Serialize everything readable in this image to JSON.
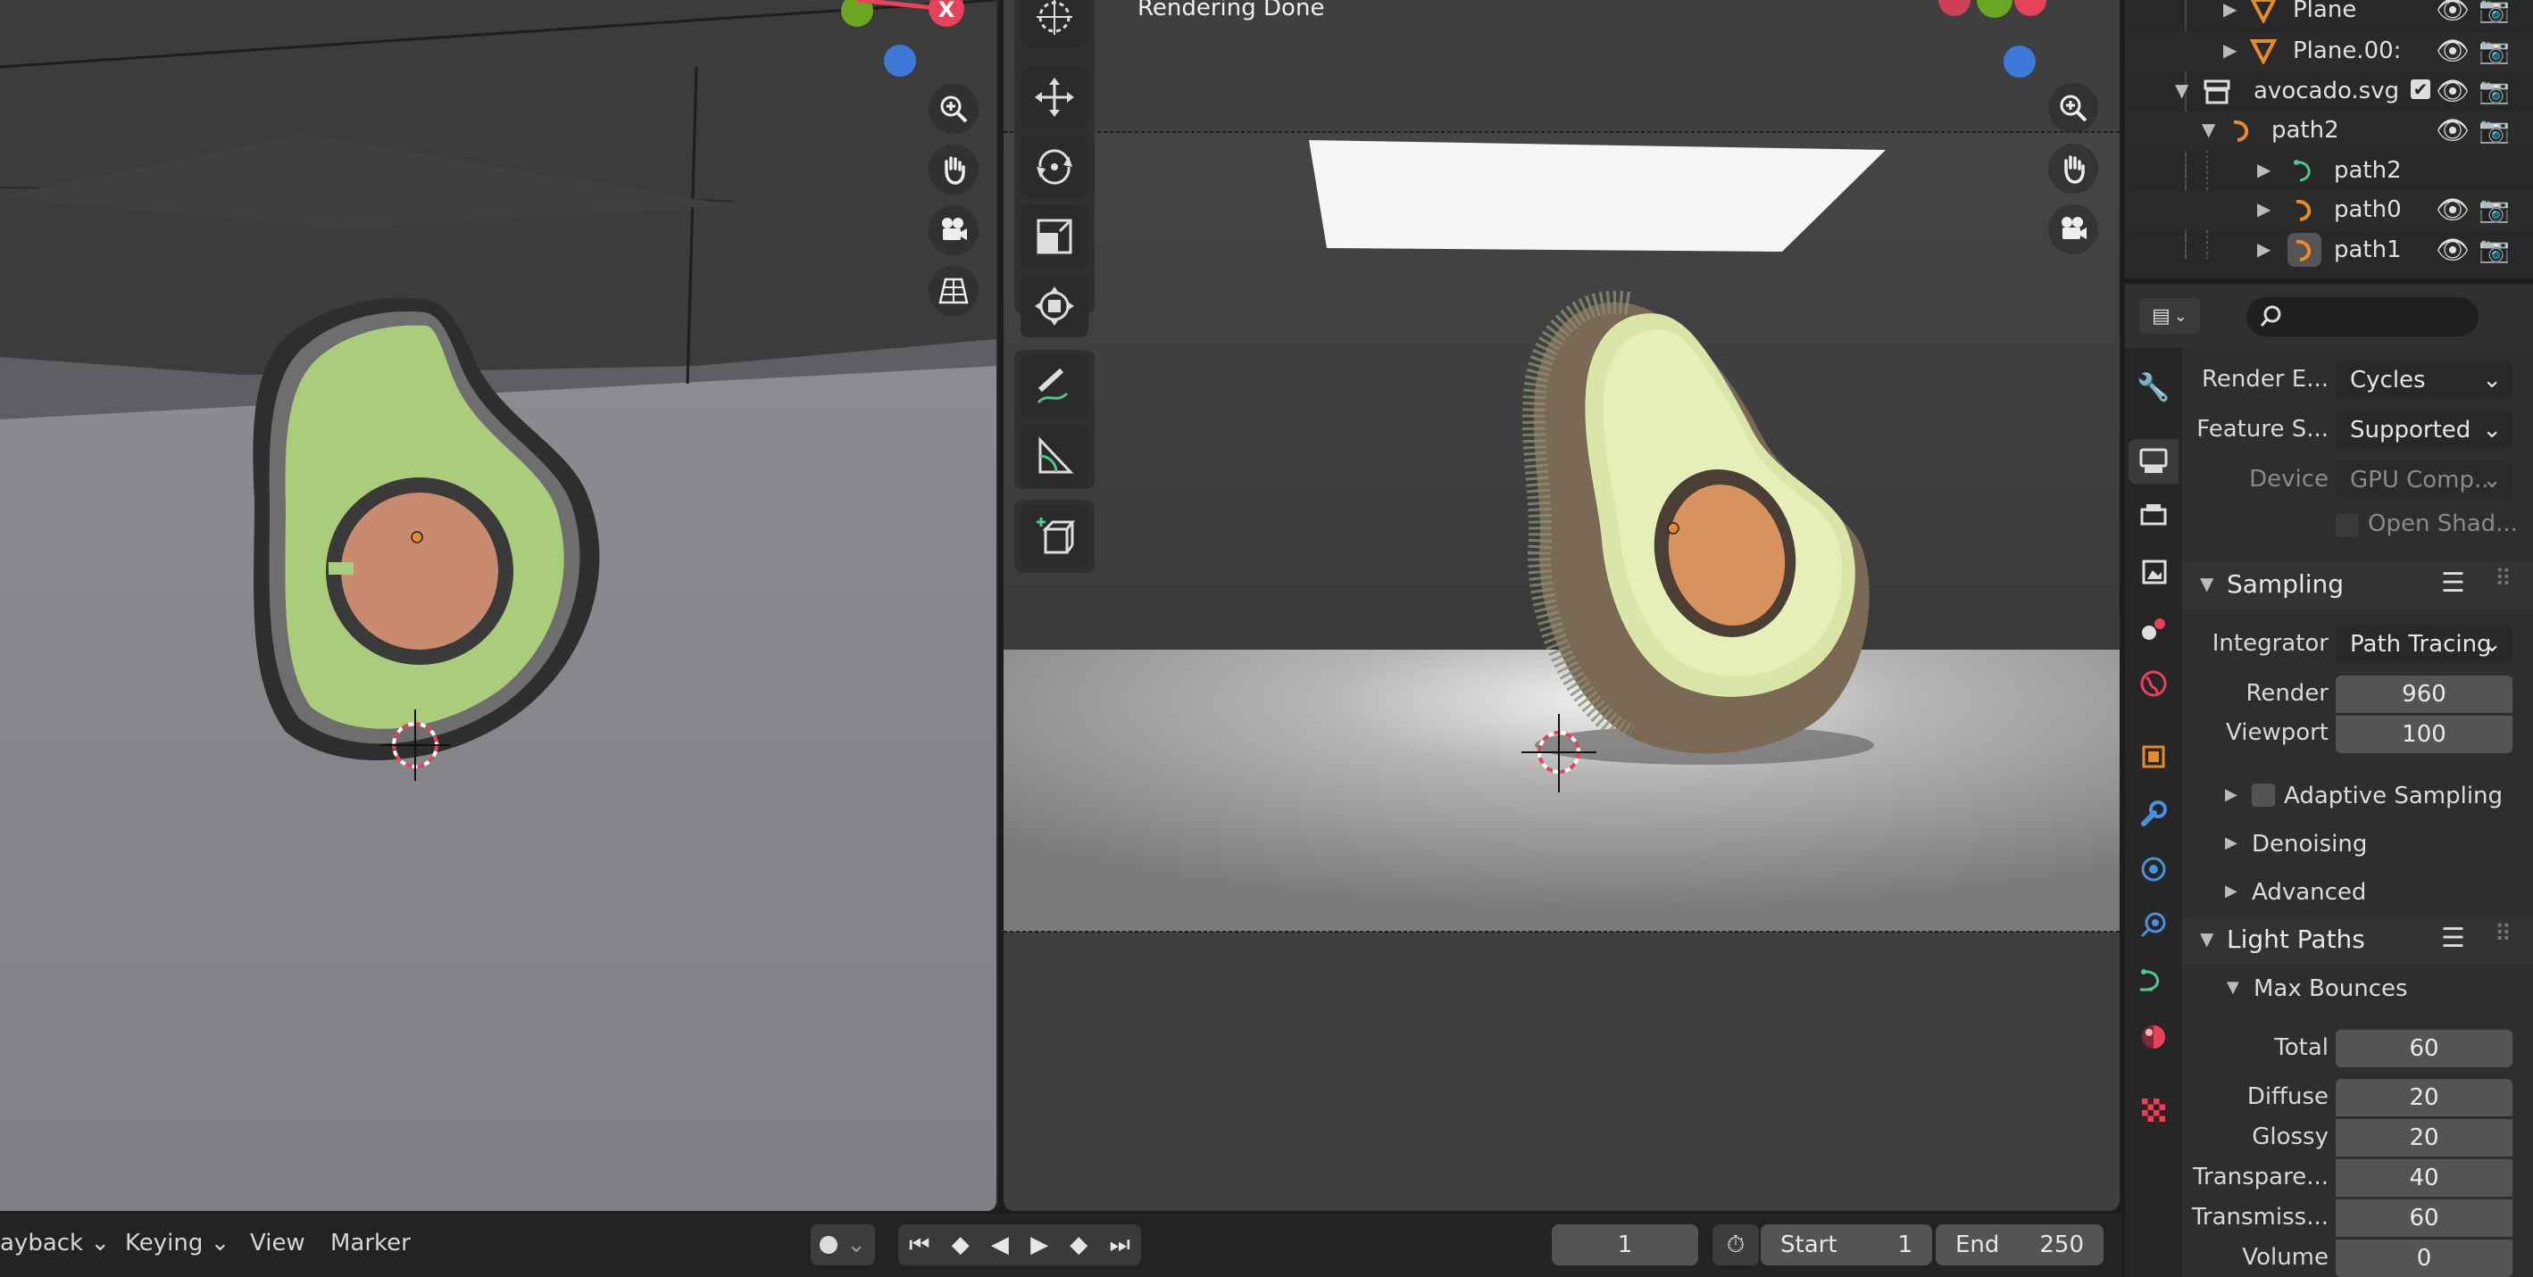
{
  "left_viewport": {},
  "right_viewport": {
    "status": "Rendering Done"
  },
  "timeline": {
    "playback_label": "ayback",
    "keying_label": "Keying",
    "view_label": "View",
    "marker_label": "Marker",
    "current_frame": "1",
    "start_label": "Start",
    "start_value": "1",
    "end_label": "End",
    "end_value": "250"
  },
  "outliner": {
    "items": [
      {
        "label": "Plane"
      },
      {
        "label": "Plane.00:"
      },
      {
        "label": "avocado.svg"
      },
      {
        "label": "path2"
      },
      {
        "label": "path2"
      },
      {
        "label": "path0"
      },
      {
        "label": "path1"
      }
    ]
  },
  "properties": {
    "render_engine_label": "Render E...",
    "render_engine_value": "Cycles",
    "feature_set_label": "Feature S...",
    "feature_set_value": "Supported",
    "device_label": "Device",
    "device_value": "GPU Comp...",
    "open_shading_label": "Open Shad...",
    "sampling": {
      "title": "Sampling",
      "integrator_label": "Integrator",
      "integrator_value": "Path Tracing",
      "render_label": "Render",
      "render_value": "960",
      "viewport_label": "Viewport",
      "viewport_value": "100",
      "adaptive_label": "Adaptive Sampling",
      "denoising_label": "Denoising",
      "advanced_label": "Advanced"
    },
    "light_paths": {
      "title": "Light Paths",
      "max_bounces_label": "Max Bounces",
      "total_label": "Total",
      "total_value": "60",
      "diffuse_label": "Diffuse",
      "diffuse_value": "20",
      "glossy_label": "Glossy",
      "glossy_value": "20",
      "transparency_label": "Transpare...",
      "transparency_value": "40",
      "transmission_label": "Transmiss...",
      "transmission_value": "60",
      "volume_label": "Volume",
      "volume_value": "0"
    }
  },
  "colors": {
    "accent_orange": "#e88a2a",
    "avocado_green": "#a9cd7a",
    "pit": "#c98b70",
    "gizmo_red": "#e8415a",
    "gizmo_green": "#6aa823",
    "gizmo_blue": "#3d79d6"
  }
}
